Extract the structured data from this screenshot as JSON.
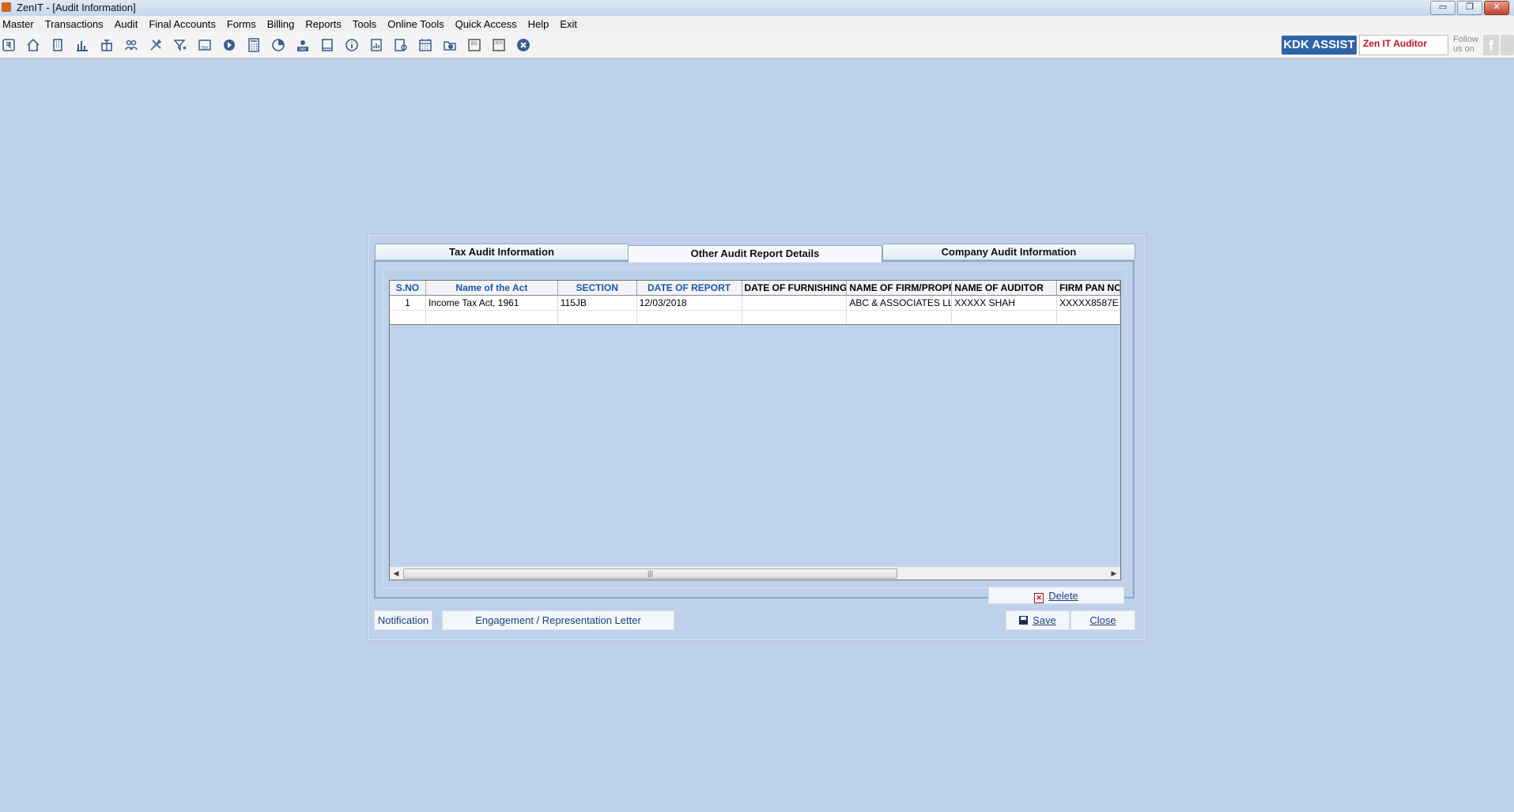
{
  "window": {
    "title": "ZenIT - [Audit Information]",
    "controls": {
      "minimize": "▭",
      "restore": "❐",
      "close": "✕"
    }
  },
  "menu": [
    "Master",
    "Transactions",
    "Audit",
    "Final Accounts",
    "Forms",
    "Billing",
    "Reports",
    "Tools",
    "Online Tools",
    "Quick Access",
    "Help",
    "Exit"
  ],
  "toolbar": {
    "icons": [
      "rupee-icon",
      "home-icon",
      "building-icon",
      "bar-chart-icon",
      "gift-icon",
      "users-icon",
      "tools-icon",
      "filter-icon",
      "tax-icon",
      "play-circle-icon",
      "calculator-icon",
      "pie-chart-icon",
      "pay-icon",
      "book-icon",
      "info-icon",
      "report-icon",
      "user-doc-icon",
      "calendar-icon",
      "folder-add-icon",
      "bs-icon",
      "3cd-icon",
      "close-circle-icon"
    ],
    "kdk_assist": "KDK ASSIST",
    "product_name": "Zen IT Auditor",
    "follow_text": "Follow us on",
    "social": "f"
  },
  "dialog": {
    "tabs": [
      {
        "label": "Tax Audit Information",
        "active": false
      },
      {
        "label": "Other Audit Report Details",
        "active": true
      },
      {
        "label": "Company Audit Information",
        "active": false
      }
    ],
    "grid": {
      "columns": [
        "S.NO",
        "Name of the Act",
        "SECTION",
        "DATE OF REPORT",
        "DATE OF FURNISHING",
        "NAME OF FIRM/PROPRI",
        "NAME OF AUDITOR",
        "FIRM PAN NO."
      ],
      "rows": [
        [
          "1",
          "Income Tax Act, 1961",
          "115JB",
          "12/03/2018",
          "",
          "ABC & ASSOCIATES LL",
          "XXXXX SHAH",
          "XXXXX8587E"
        ]
      ],
      "scroll_thumb_grip": "|||"
    },
    "buttons": {
      "delete": "Delete",
      "notification": "Notification",
      "engagement": "Engagement / Representation Letter",
      "save": "Save",
      "close": "Close"
    }
  }
}
